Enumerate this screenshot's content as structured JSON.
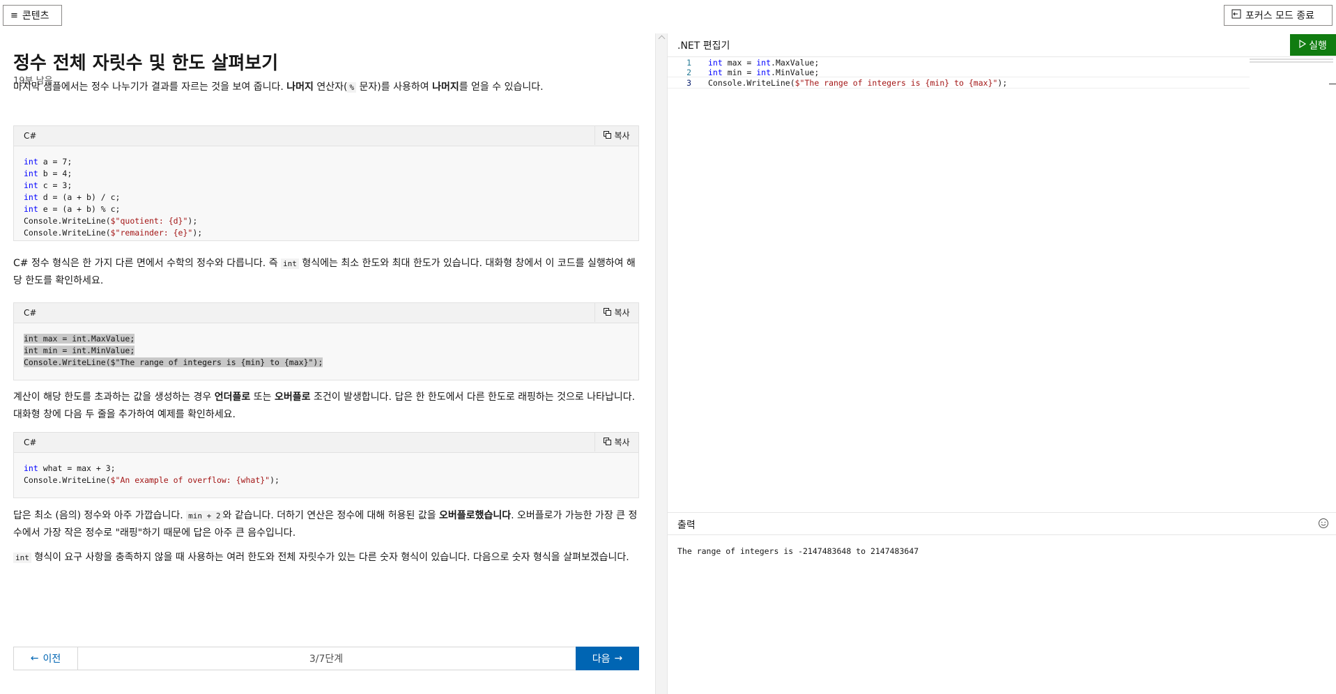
{
  "topbar": {
    "contents_label": "콘텐츠",
    "focus_exit_label": "포커스 모드 종료"
  },
  "article": {
    "title": "정수 전체 자릿수 및 한도 살펴보기",
    "time_left": "19분 남음",
    "p1": {
      "a": "마지막 샘플에서는 정수 나누기가 결과를 자르는 것을 보여 줍니다. ",
      "b1": "나머지",
      "c": " 연산자(",
      "code": "%",
      "d": " 문자)를 사용하여 ",
      "b2": "나머지",
      "e": "를 얻을 수 있습니다."
    },
    "copy_label": "복사",
    "code_lang": "C#",
    "code1": {
      "l1": {
        "kw": "int",
        "rest": " a = 7;"
      },
      "l2": {
        "kw": "int",
        "rest": " b = 4;"
      },
      "l3": {
        "kw": "int",
        "rest": " c = 3;"
      },
      "l4": {
        "kw": "int",
        "rest": " d = (a + b) / c;"
      },
      "l5": {
        "kw": "int",
        "rest": " e = (a + b) % c;"
      },
      "l6": {
        "pre": "Console.WriteLine(",
        "str": "$\"quotient: {d}\"",
        "post": ");"
      },
      "l7": {
        "pre": "Console.WriteLine(",
        "str": "$\"remainder: {e}\"",
        "post": ");"
      }
    },
    "p2": {
      "a": "C# 정수 형식은 한 가지 다른 면에서 수학의 정수와 다릅니다. 즉 ",
      "code": "int",
      "b": " 형식에는 최소 한도와 최대 한도가 있습니다. 대화형 창에서 이 코드를 실행하여 해당 한도를 확인하세요."
    },
    "code2": {
      "l1": "int max = int.MaxValue;",
      "l2": "int min = int.MinValue;",
      "l3": "Console.WriteLine($\"The range of integers is {min} to {max}\");"
    },
    "p3": {
      "a": "계산이 해당 한도를 초과하는 값을 생성하는 경우 ",
      "b1": "언더플로",
      "c": " 또는 ",
      "b2": "오버플로",
      "d": " 조건이 발생합니다. 답은 한 한도에서 다른 한도로 래핑하는 것으로 나타납니다. 대화형 창에 다음 두 줄을 추가하여 예제를 확인하세요."
    },
    "code3": {
      "l1": {
        "kw": "int",
        "rest": " what = max + 3;"
      },
      "l2": {
        "pre": "Console.WriteLine(",
        "str": "$\"An example of overflow: {what}\"",
        "post": ");"
      }
    },
    "p4": {
      "a": "답은 최소 (음의) 정수와 아주 가깝습니다. ",
      "code": "min + 2",
      "b": "와 같습니다. 더하기 연산은 정수에 대해 허용된 값을 ",
      "b1": "오버플로했습니다",
      "c": ". 오버플로가 가능한 가장 큰 정수에서 가장 작은 정수로 \"래핑\"하기 때문에 답은 아주 큰 음수입니다."
    },
    "p5": {
      "code": "int",
      "a": " 형식이 요구 사항을 충족하지 않을 때 사용하는 여러 한도와 전체 자릿수가 있는 다른 숫자 형식이 있습니다. 다음으로 숫자 형식을 살펴보겠습니다."
    }
  },
  "pager": {
    "prev_label": "이전",
    "step_label": "3/7단계",
    "next_label": "다음"
  },
  "editor": {
    "title": ".NET 편집기",
    "run_label": "실행",
    "lines": [
      {
        "n": "1",
        "kw1": "int",
        "a": " max = ",
        "kw2": "int",
        "b": ".MaxValue;"
      },
      {
        "n": "2",
        "kw1": "int",
        "a": " min = ",
        "kw2": "int",
        "b": ".MinValue;"
      },
      {
        "n": "3",
        "pre": "Console.WriteLine(",
        "str": "$\"The range of integers is {min} to {max}\"",
        "post": ");"
      }
    ]
  },
  "output": {
    "title": "출력",
    "text": "The range of integers is -2147483648 to 2147483647"
  },
  "colors": {
    "run": "#107c10",
    "next": "#0065b3",
    "keyword": "#0000ff",
    "string": "#a31515",
    "line_number": "#237893"
  }
}
